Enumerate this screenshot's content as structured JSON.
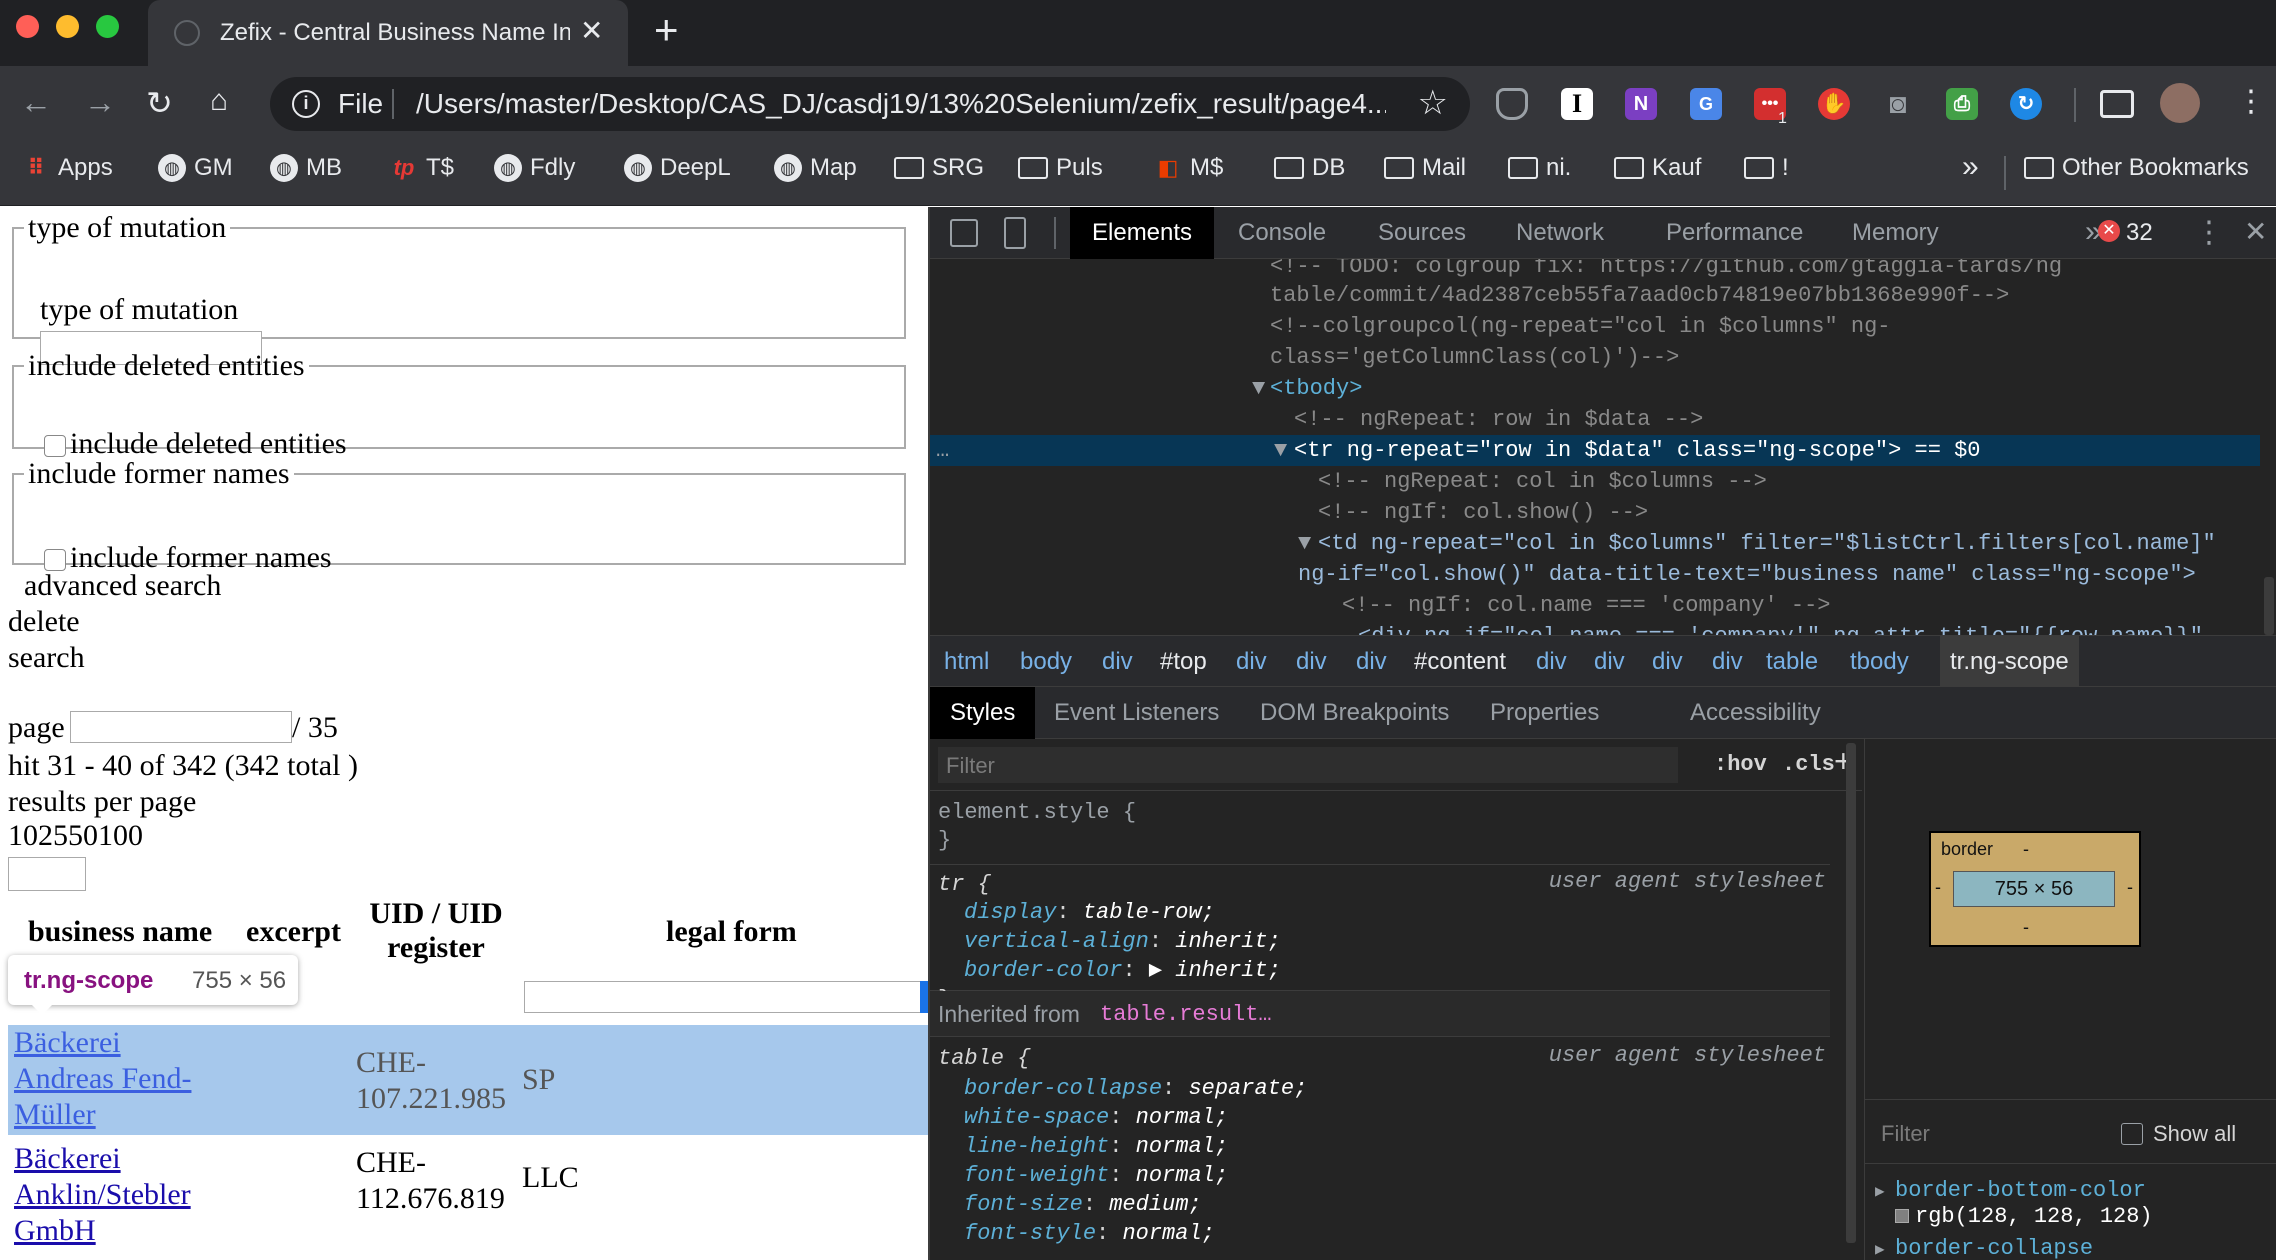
{
  "browser": {
    "tab_title": "Zefix - Central Business Name In",
    "omnibox": {
      "scheme_label": "File",
      "url": "/Users/master/Desktop/CAS_DJ/casdj19/13%20Selenium/zefix_result/page4..."
    },
    "extension_badge": "1",
    "bookmarks": [
      {
        "label": "Apps",
        "icon": "apps-grid-icon"
      },
      {
        "label": "GM",
        "icon": "globe-icon"
      },
      {
        "label": "MB",
        "icon": "globe-icon"
      },
      {
        "label": "T$",
        "icon": "tp-logo-icon"
      },
      {
        "label": "Fdly",
        "icon": "globe-icon"
      },
      {
        "label": "DeepL",
        "icon": "globe-icon"
      },
      {
        "label": "Map",
        "icon": "globe-icon"
      },
      {
        "label": "SRG",
        "icon": "folder-icon"
      },
      {
        "label": "Puls",
        "icon": "folder-icon"
      },
      {
        "label": "M$",
        "icon": "office-icon"
      },
      {
        "label": "DB",
        "icon": "folder-icon"
      },
      {
        "label": "Mail",
        "icon": "folder-icon"
      },
      {
        "label": "ni.",
        "icon": "folder-icon"
      },
      {
        "label": "Kauf",
        "icon": "folder-icon"
      },
      {
        "label": "!",
        "icon": "folder-icon"
      }
    ],
    "overflow": "»",
    "other_bookmarks": "Other Bookmarks"
  },
  "page": {
    "mutation_legend": "type of mutation",
    "mutation_label": "type of mutation",
    "deleted_legend": "include deleted entities",
    "deleted_label": "include deleted entities",
    "former_legend": "include former names",
    "former_label": "include former names",
    "advanced_search": "advanced search",
    "delete": "delete",
    "search": "search",
    "page_label": "page",
    "page_total": "/ 35",
    "hits": "hit 31 - 40 of 342 (342 total )",
    "per_page_label": "results per page",
    "per_page_options": "102550100",
    "headers": {
      "name": "business name",
      "excerpt": "excerpt",
      "uid": "UID / UID register",
      "legal": "legal form"
    },
    "rows": [
      {
        "name_lines": [
          "Bäckerei",
          "Andreas Fend-",
          "Müller"
        ],
        "uid_lines": [
          "CHE-",
          "107.221.985"
        ],
        "legal": "SP"
      },
      {
        "name_lines": [
          "Bäckerei",
          "Anklin/Stebler",
          "GmbH"
        ],
        "uid_lines": [
          "CHE-",
          "112.676.819"
        ],
        "legal": "LLC"
      }
    ],
    "tooltip": {
      "selector": "tr.ng-scope",
      "size": "755 × 56"
    }
  },
  "devtools": {
    "tabs": [
      "Elements",
      "Console",
      "Sources",
      "Network",
      "Performance",
      "Memory"
    ],
    "more": "»",
    "error_count": "32",
    "dom_lines": [
      "<!-- TODO: colgroup fix: https://github.com/gtaggia-tards/ng",
      "table/commit/4ad2387ceb55fa7aad0cb74819e07bb1368e990f-->",
      "<!--colgroupcol(ng-repeat=\"col in $columns\" ng-",
      "class='getColumnClass(col)')-->",
      "<tbody>",
      "<!-- ngRepeat: row in $data -->",
      "<tr ng-repeat=\"row in $data\" class=\"ng-scope\"> == $0",
      "<!-- ngRepeat: col in $columns -->",
      "<!-- ngIf: col.show() -->",
      "<td ng-repeat=\"col in $columns\" filter=\"$listCtrl.filters[col.name]\"",
      "ng-if=\"col.show()\" data-title-text=\"business name\" class=\"ng-scope\">",
      "<!-- ngIf: col.name === 'company' -->",
      "<div ng-if=\"col.name === 'company'\" ng-attr-title=\"{{row.name}}\""
    ],
    "breadcrumbs": [
      "html",
      "body",
      "div",
      "#top",
      "div",
      "div",
      "div",
      "#content",
      "div",
      "div",
      "div",
      "div",
      "table",
      "tbody",
      "tr.ng-scope"
    ],
    "subtabs": [
      "Styles",
      "Event Listeners",
      "DOM Breakpoints",
      "Properties",
      "Accessibility"
    ],
    "styles": {
      "filter_placeholder": "Filter",
      "hov": ":hov",
      "cls": ".cls",
      "element_style": "element.style {",
      "close": "}",
      "tr_selector": "tr {",
      "ua": "user agent stylesheet",
      "tr_props": [
        [
          "display",
          "table-row;"
        ],
        [
          "vertical-align",
          "inherit;"
        ],
        [
          "border-color",
          "▶ inherit;"
        ]
      ],
      "inherited_label": "Inherited from",
      "inherited_from": "table.result…",
      "table_selector": "table {",
      "table_props": [
        [
          "border-collapse",
          "separate;"
        ],
        [
          "white-space",
          "normal;"
        ],
        [
          "line-height",
          "normal;"
        ],
        [
          "font-weight",
          "normal;"
        ],
        [
          "font-size",
          "medium;"
        ],
        [
          "font-style",
          "normal;"
        ]
      ]
    },
    "boxmodel": {
      "border_label": "border",
      "dash": "-",
      "content": "755 × 56",
      "filter_placeholder": "Filter",
      "show_all": "Show all",
      "computed": [
        {
          "name": "border-bottom-color",
          "value": "rgb(128, 128, 128)"
        },
        {
          "name": "border-collapse",
          "value": ""
        }
      ]
    }
  }
}
